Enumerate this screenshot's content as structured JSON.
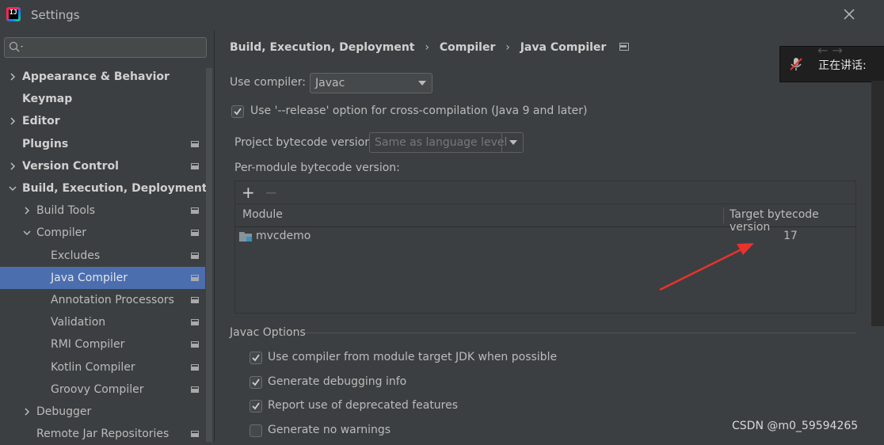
{
  "window": {
    "title": "Settings",
    "app_icon_text": "IJ"
  },
  "search": {
    "placeholder": ""
  },
  "sidebar": {
    "items": [
      {
        "label": "Appearance & Behavior",
        "bold": true
      },
      {
        "label": "Keymap",
        "bold": true
      },
      {
        "label": "Editor",
        "bold": true
      },
      {
        "label": "Plugins",
        "bold": true
      },
      {
        "label": "Version Control",
        "bold": true
      },
      {
        "label": "Build, Execution, Deployment",
        "bold": true
      },
      {
        "label": "Build Tools"
      },
      {
        "label": "Compiler"
      },
      {
        "label": "Excludes"
      },
      {
        "label": "Java Compiler",
        "selected": true
      },
      {
        "label": "Annotation Processors"
      },
      {
        "label": "Validation"
      },
      {
        "label": "RMI Compiler"
      },
      {
        "label": "Kotlin Compiler"
      },
      {
        "label": "Groovy Compiler"
      },
      {
        "label": "Debugger"
      },
      {
        "label": "Remote Jar Repositories"
      }
    ]
  },
  "breadcrumb": {
    "items": [
      "Build, Execution, Deployment",
      "Compiler",
      "Java Compiler"
    ],
    "separator": "›"
  },
  "compiler": {
    "use_compiler_label": "Use compiler:",
    "use_compiler_value": "Javac",
    "release_option_label": "Use '--release' option for cross-compilation (Java 9 and later)",
    "release_option_checked": true,
    "project_bytecode_label": "Project bytecode version:",
    "project_bytecode_value": "Same as language level",
    "per_module_label": "Per-module bytecode version:"
  },
  "table": {
    "add_label": "+",
    "remove_label": "−",
    "columns": [
      "Module",
      "Target bytecode version"
    ],
    "rows": [
      {
        "module": "mvcdemo",
        "target": "17"
      }
    ]
  },
  "javac_options": {
    "title": "Javac Options",
    "options": [
      {
        "label": "Use compiler from module target JDK when possible",
        "checked": true
      },
      {
        "label": "Generate debugging info",
        "checked": true
      },
      {
        "label": "Report use of deprecated features",
        "checked": true
      },
      {
        "label": "Generate no warnings",
        "checked": false
      }
    ]
  },
  "notification": {
    "text": "正在讲话:"
  },
  "watermark": {
    "text": "CSDN @m0_59594265"
  },
  "colors": {
    "background": "#3c3f41",
    "selection": "#4b6eaf",
    "annotation_arrow": "#e8322e"
  }
}
